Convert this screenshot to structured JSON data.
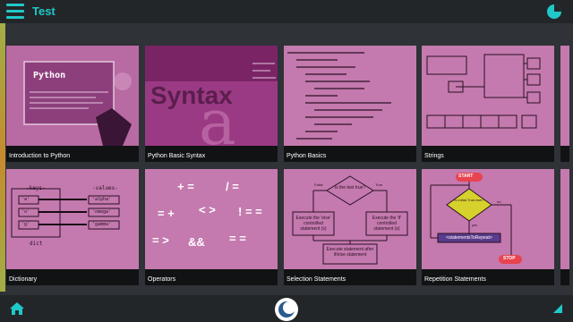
{
  "app": {
    "title": "Test"
  },
  "tiles": [
    {
      "label": "Introduction to Python",
      "thumb_text": "Python"
    },
    {
      "label": "Python Basic Syntax",
      "thumb_text": "Syntax"
    },
    {
      "label": "Python Basics"
    },
    {
      "label": "Strings"
    },
    {
      "label": "Dictionary"
    },
    {
      "label": "Operators"
    },
    {
      "label": "Selection Statements"
    },
    {
      "label": "Repetition Statements"
    }
  ],
  "thumbs": {
    "dictionary": {
      "keys": "-keys-",
      "values": "-values-",
      "k1": "'a'",
      "k2": "'o'",
      "k3": "'g'",
      "v1": "'alpha'",
      "v2": "'omega'",
      "v3": "'gamma'",
      "caption": "dict"
    },
    "selection": {
      "cond": "Is the test true?",
      "no": "False",
      "yes": "True",
      "else": "Execute the 'else' controlled statement (s)",
      "if": "Execute the 'if' controlled statement (s)",
      "after": "Execute statement after if/else statement"
    },
    "repetition": {
      "start": "START",
      "cond": "Is initial-True-true?",
      "yes": "yes",
      "no": "no",
      "stmt": "<statementsToRepeat>",
      "stop": "STOP"
    },
    "operators": {
      "ops": [
        "+ =",
        "/ =",
        "= +",
        "< >",
        "! = =",
        "= >",
        "&&",
        "= ="
      ]
    }
  },
  "colors": {
    "accent": "#20c9c9",
    "thumb": "#c47aae",
    "tile_bg": "#111214"
  },
  "icons": {
    "menu": "hamburger-menu-icon",
    "pie": "pie-chart-icon",
    "home": "home-icon",
    "center": "app-logo-icon",
    "expand": "expand-icon"
  }
}
